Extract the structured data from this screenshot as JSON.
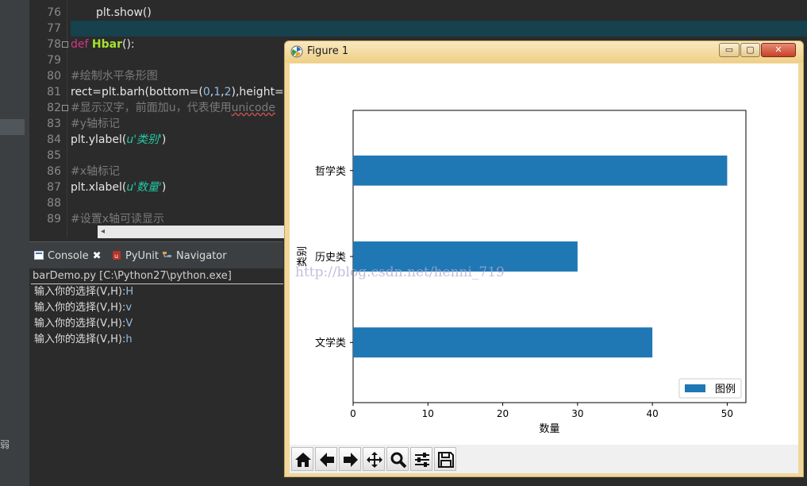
{
  "editor": {
    "lines": [
      {
        "n": "76",
        "type": "show",
        "text": "plt.show()"
      },
      {
        "n": "77",
        "type": "blank"
      },
      {
        "n": "78",
        "type": "def",
        "kw": "def",
        "name": "Hbar",
        "rest": "():"
      },
      {
        "n": "79",
        "type": "blank"
      },
      {
        "n": "80",
        "type": "comment",
        "text": "#绘制水平条形图"
      },
      {
        "n": "81",
        "type": "barh",
        "pre": "rect=plt.barh(bottom=(",
        "n1": "0",
        "c1": ",",
        "n2": "1",
        "c2": ",",
        "n3": "2",
        "post": "),height=("
      },
      {
        "n": "82",
        "type": "comment2",
        "text": "#显示汉字，前面加u，代表使用",
        "und": "unicode"
      },
      {
        "n": "83",
        "type": "comment",
        "text": "#y轴标记"
      },
      {
        "n": "84",
        "type": "call",
        "pre": "plt.ylabel(",
        "str": "u'类别'",
        "post": ")"
      },
      {
        "n": "85",
        "type": "blank"
      },
      {
        "n": "86",
        "type": "comment",
        "text": "#x轴标记"
      },
      {
        "n": "87",
        "type": "call",
        "pre": "plt.xlabel(",
        "str": "u'数量'",
        "post": ")"
      },
      {
        "n": "88",
        "type": "blank"
      },
      {
        "n": "89",
        "type": "comment",
        "text": "#设置x轴可读显示"
      }
    ]
  },
  "left_strip": {
    "glyph": "弱"
  },
  "console": {
    "tabs": [
      {
        "label": "Console",
        "icon": "console-icon",
        "closable": true
      },
      {
        "label": "PyUnit",
        "icon": "pyunit-icon"
      },
      {
        "label": "Navigator",
        "icon": "navigator-icon"
      }
    ],
    "process": "barDemo.py [C:\\Python27\\python.exe]",
    "lines": [
      {
        "prompt": "输入你的选择(V,H):",
        "input": "H"
      },
      {
        "prompt": "输入你的选择(V,H):",
        "input": "v"
      },
      {
        "prompt": "输入你的选择(V,H):",
        "input": "V"
      },
      {
        "prompt": "输入你的选择(V,H):",
        "input": "h"
      }
    ]
  },
  "figure": {
    "title": "Figure 1",
    "buttons": {
      "minimize": "▭",
      "maximize": "▢",
      "close": "✕"
    },
    "watermark": "http://blog.csdn.net/henni_719",
    "toolbar": [
      "home-icon",
      "back-icon",
      "forward-icon",
      "pan-icon",
      "zoom-icon",
      "configure-subplots-icon",
      "save-icon"
    ]
  },
  "chart_data": {
    "type": "bar",
    "orientation": "horizontal",
    "categories": [
      "文学类",
      "历史类",
      "哲学类"
    ],
    "values": [
      40,
      30,
      50
    ],
    "xlabel": "数量",
    "ylabel": "类别",
    "xticks": [
      0,
      10,
      20,
      30,
      40,
      50
    ],
    "xlim": [
      0,
      52.5
    ],
    "legend": {
      "label": "图例",
      "position": "lower right"
    },
    "bar_color": "#1f77b4",
    "grid": false
  },
  "colors": {
    "bar": "#1f77b4",
    "editor_bg": "#2b2b2b",
    "current_line": "#16414d",
    "title_bar": "#efcf87"
  }
}
